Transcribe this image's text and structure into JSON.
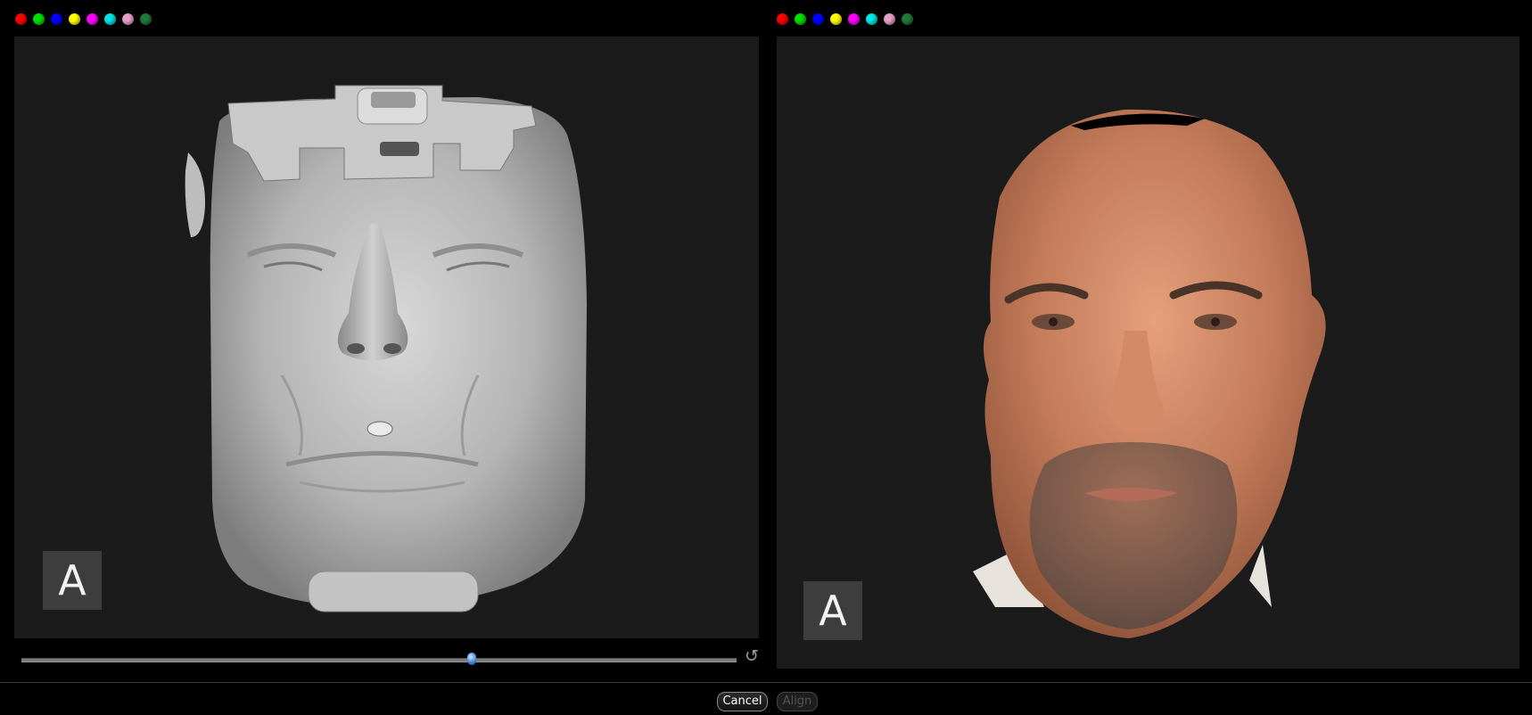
{
  "color_markers": [
    {
      "name": "red",
      "color": "#ff0000"
    },
    {
      "name": "green",
      "color": "#00e000"
    },
    {
      "name": "blue",
      "color": "#0000ff"
    },
    {
      "name": "yellow",
      "color": "#ffff00"
    },
    {
      "name": "magenta",
      "color": "#ff00ff"
    },
    {
      "name": "cyan",
      "color": "#00e5e5"
    },
    {
      "name": "pink",
      "color": "#e6a0c8"
    },
    {
      "name": "dark-green",
      "color": "#1f7a3a"
    }
  ],
  "left_view": {
    "orientation_label": "A",
    "content": "ct-skin-surface-render"
  },
  "right_view": {
    "orientation_label": "A",
    "content": "textured-3d-face-photo"
  },
  "threshold_slider": {
    "position_fraction": 0.63
  },
  "buttons": {
    "cancel_label": "Cancel",
    "align_label": "Align"
  },
  "icons": {
    "reset": "reset-icon"
  }
}
